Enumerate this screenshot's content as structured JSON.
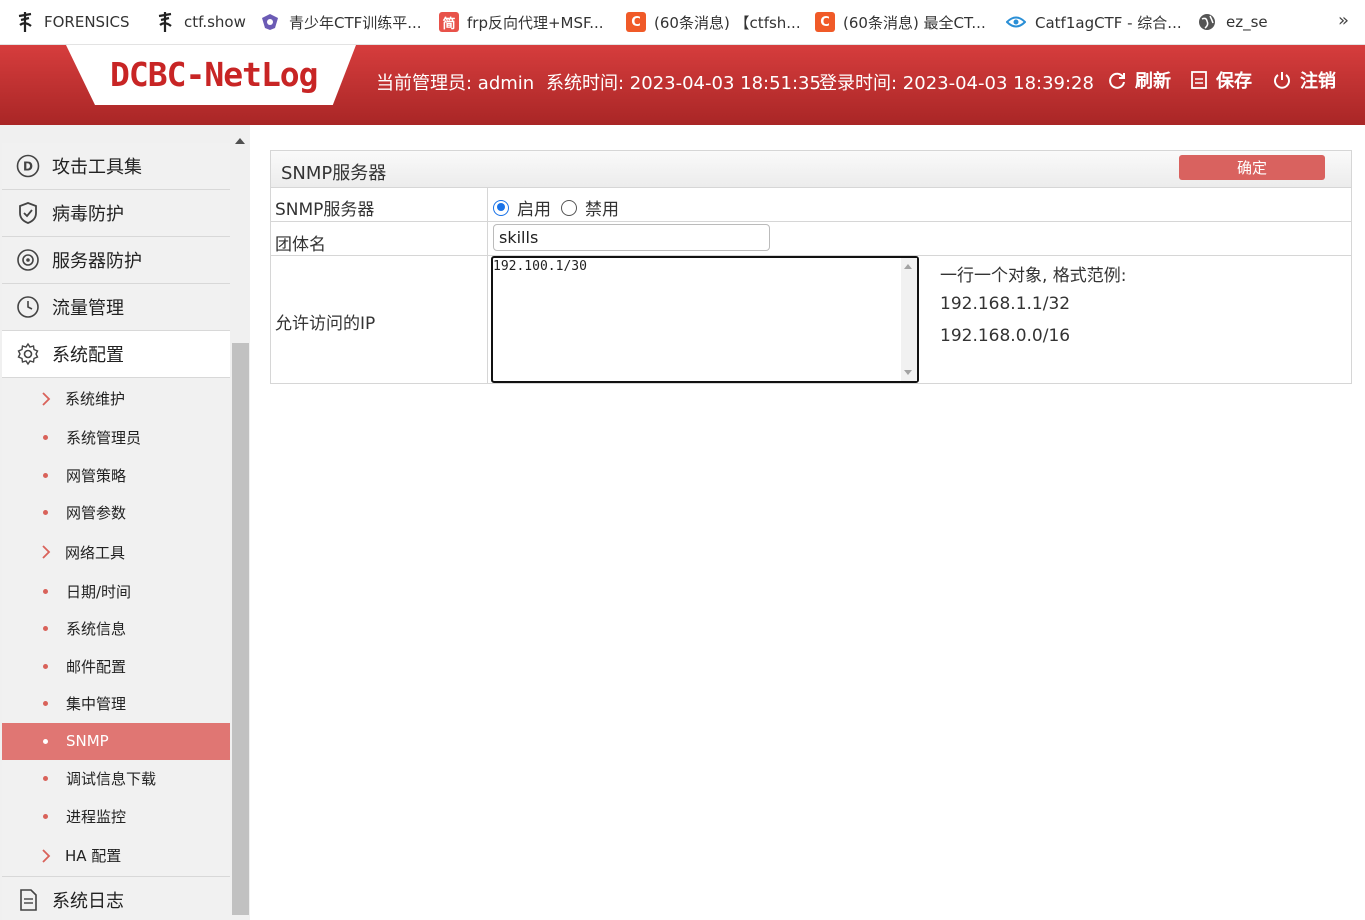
{
  "bookmarks": [
    {
      "label": "FORENSICS",
      "icon": "tree-glyph-icon"
    },
    {
      "label": "ctf.show",
      "icon": "tree-glyph-icon"
    },
    {
      "label": "青少年CTF训练平...",
      "icon": "shield-logo-icon"
    },
    {
      "label": "frp反向代理+MSF...",
      "icon": "jian-icon",
      "glyph": "简"
    },
    {
      "label": "(60条消息) 【ctfsh...",
      "icon": "csdn-icon",
      "glyph": "C"
    },
    {
      "label": "(60条消息) 最全CT...",
      "icon": "csdn-icon",
      "glyph": "C"
    },
    {
      "label": "Catf1agCTF - 综合...",
      "icon": "eye-logo-icon"
    },
    {
      "label": "ez_se",
      "icon": "globe-icon"
    }
  ],
  "bookmarks_more": "»",
  "header": {
    "logo": "DCBC-NetLog",
    "admin": "当前管理员: admin",
    "system_time": "系统时间: 2023-04-03 18:51:35",
    "login_time": "登录时间: 2023-04-03 18:39:28",
    "refresh": "刷新",
    "save": "保存",
    "logout": "注销"
  },
  "sidebar": {
    "top_items": [
      {
        "label": "攻击工具集",
        "icon": "d-circle-icon"
      },
      {
        "label": "病毒防护",
        "icon": "shield-check-icon"
      },
      {
        "label": "服务器防护",
        "icon": "target-icon"
      },
      {
        "label": "流量管理",
        "icon": "clock-icon"
      },
      {
        "label": "系统配置",
        "icon": "gear-icon"
      }
    ],
    "sub_items": [
      {
        "label": "系统维护",
        "marker": "chevron"
      },
      {
        "label": "系统管理员",
        "marker": "dot"
      },
      {
        "label": "网管策略",
        "marker": "dot"
      },
      {
        "label": "网管参数",
        "marker": "dot"
      },
      {
        "label": "网络工具",
        "marker": "chevron"
      },
      {
        "label": "日期/时间",
        "marker": "dot"
      },
      {
        "label": "系统信息",
        "marker": "dot"
      },
      {
        "label": "邮件配置",
        "marker": "dot"
      },
      {
        "label": "集中管理",
        "marker": "dot"
      },
      {
        "label": "SNMP",
        "marker": "dot",
        "active": true
      },
      {
        "label": "调试信息下载",
        "marker": "dot"
      },
      {
        "label": "进程监控",
        "marker": "dot"
      },
      {
        "label": "HA 配置",
        "marker": "chevron"
      }
    ],
    "bottom_item": {
      "label": "系统日志",
      "icon": "document-icon"
    }
  },
  "panel": {
    "title": "SNMP服务器",
    "confirm": "确定",
    "rows": {
      "server_label": "SNMP服务器",
      "enable": "启用",
      "disable": "禁用",
      "selected": "启用",
      "community_label": "团体名",
      "community_value": "skills",
      "ip_label": "允许访问的IP",
      "ip_value": "192.100.1/30",
      "hint_title": "一行一个对象, 格式范例:",
      "hint_ex1": "192.168.1.1/32",
      "hint_ex2": "192.168.0.0/16"
    }
  },
  "colors": {
    "header_red": "#c22f2f",
    "active_item": "#e07673",
    "button": "#d9625f",
    "radio_blue": "#1a73e8"
  }
}
